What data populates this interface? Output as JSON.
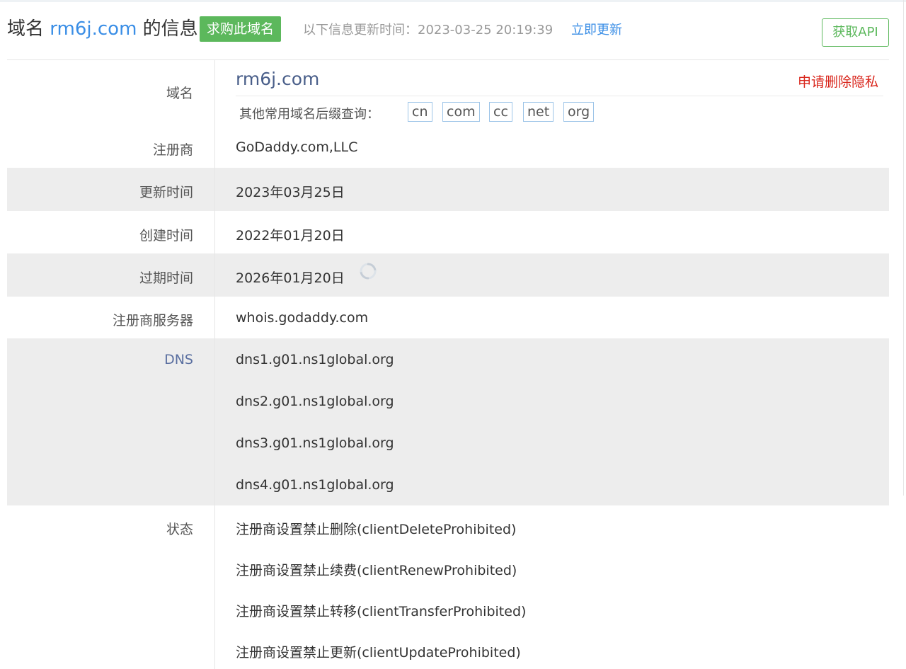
{
  "header": {
    "title_prefix": "域名",
    "domain": "rm6j.com",
    "title_suffix": "的信息",
    "buy_button": "求购此域名",
    "update_text": "以下信息更新时间：2023-03-25 20:19:39",
    "update_link": "立即更新",
    "api_button": "获取API"
  },
  "domain_row": {
    "label": "域名",
    "domain": "rm6j.com",
    "privacy_link": "申请删除隐私",
    "suffix_label": "其他常用域名后缀查询：",
    "suffixes": [
      "cn",
      "com",
      "cc",
      "net",
      "org"
    ]
  },
  "rows": {
    "registrar": {
      "label": "注册商",
      "value": "GoDaddy.com,LLC"
    },
    "updated": {
      "label": "更新时间",
      "value": "2023年03月25日"
    },
    "created": {
      "label": "创建时间",
      "value": "2022年01月20日"
    },
    "expires": {
      "label": "过期时间",
      "value": "2026年01月20日"
    },
    "whois_server": {
      "label": "注册商服务器",
      "value": "whois.godaddy.com"
    },
    "dns": {
      "label": "DNS",
      "values": [
        "dns1.g01.ns1global.org",
        "dns2.g01.ns1global.org",
        "dns3.g01.ns1global.org",
        "dns4.g01.ns1global.org"
      ]
    },
    "status": {
      "label": "状态",
      "values": [
        "注册商设置禁止删除(clientDeleteProhibited)",
        "注册商设置禁止续费(clientRenewProhibited)",
        "注册商设置禁止转移(clientTransferProhibited)",
        "注册商设置禁止更新(clientUpdateProhibited)"
      ]
    }
  },
  "icons": {
    "refresh": "refresh-icon"
  },
  "colors": {
    "accent": "#3a8ee6",
    "buy_green": "#5cb85c",
    "privacy_red": "#d9261c",
    "row_gray": "#ededed"
  }
}
